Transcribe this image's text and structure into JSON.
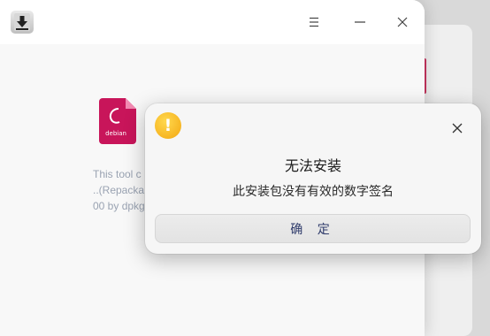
{
  "background_window": {
    "accent_color": "#c8355f"
  },
  "main_window": {
    "app_icon": "download-arrow-icon",
    "titlebar_buttons": {
      "menu_icon": "hamburger-menu-icon",
      "minimize_icon": "minimize-icon",
      "close_icon": "close-icon"
    },
    "package": {
      "icon": "debian-package-icon",
      "icon_label": "debian",
      "icon_color": "#c8155a",
      "description_lines": [
        "This tool c",
        "..(Repacka",
        "00 by dpkg"
      ]
    }
  },
  "dialog": {
    "icon": "warning-icon",
    "icon_color": "#f5b316",
    "title": "无法安装",
    "message": "此安装包没有有效的数字签名",
    "confirm_label": "确 定",
    "confirm_text_color": "#2f3b6b",
    "close_icon": "close-icon"
  }
}
